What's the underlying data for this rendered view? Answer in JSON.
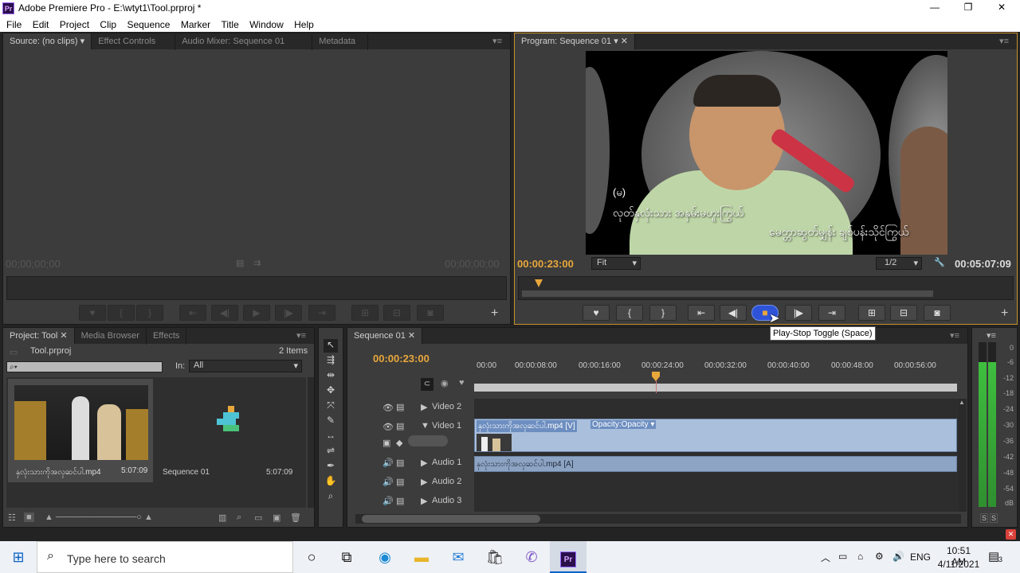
{
  "window": {
    "title": "Adobe Premiere Pro - E:\\wtyt1\\Tool.prproj *",
    "app_icon": "Pr",
    "controls": {
      "minimize": "—",
      "maximize": "❐",
      "close": "✕"
    }
  },
  "menu": [
    "File",
    "Edit",
    "Project",
    "Clip",
    "Sequence",
    "Marker",
    "Title",
    "Window",
    "Help"
  ],
  "source_panel": {
    "tabs": [
      "Source: (no clips)",
      "Effect Controls",
      "Audio Mixer: Sequence 01",
      "Metadata"
    ],
    "timecode_left": "00;00;00;00",
    "timecode_right": "00;00;00;00"
  },
  "program_panel": {
    "tab": "Program: Sequence 01",
    "timecode_left": "00:00:23:00",
    "fit_label": "Fit",
    "resolution": "1/2",
    "timecode_right": "00:05:07:09",
    "subtitle_tag": "(မ)",
    "subtitle_line1": "လုတ်နှလုံးသား အနှမ်းမဟူးကြွယ်",
    "subtitle_line2": "မေတ္တာဆွတ်မျှန်း ချစ်ပန်းသိုင်ကြွယ်",
    "tooltip": "Play-Stop Toggle (Space)"
  },
  "project_panel": {
    "tabs": [
      "Project: Tool",
      "Media Browser",
      "Effects"
    ],
    "project_name": "Tool.prproj",
    "item_count": "2 Items",
    "in_label": "In:",
    "in_value": "All",
    "items": [
      {
        "name": "နှလုံးသားကိုအလှဆင်ပါ.mp4",
        "duration": "5:07:09"
      },
      {
        "name": "Sequence 01",
        "duration": "5:07:09"
      }
    ]
  },
  "timeline_panel": {
    "tab": "Sequence 01",
    "timecode": "00:00:23:00",
    "ruler": [
      "00:00",
      "00:00:08:00",
      "00:00:16:00",
      "00:00:24:00",
      "00:00:32:00",
      "00:00:40:00",
      "00:00:48:00",
      "00:00:56:00"
    ],
    "tracks": [
      {
        "name": "Video 2"
      },
      {
        "name": "Video 1"
      },
      {
        "name": "Audio 1"
      },
      {
        "name": "Audio 2"
      },
      {
        "name": "Audio 3"
      }
    ],
    "video_clip": "နှလုံးသားကိုအလှဆင်ပါ.mp4 [V]",
    "opacity_label": "Opacity:Opacity ▾",
    "audio_clip": "နှလုံးသားကိုအလှဆင်ပါ.mp4 [A]"
  },
  "audio_meter": {
    "labels": [
      "0",
      "-6",
      "-12",
      "-18",
      "-24",
      "-30",
      "-36",
      "-42",
      "-48",
      "-54",
      "dB"
    ],
    "bottom": [
      "S",
      "S"
    ]
  },
  "taskbar": {
    "search_placeholder": "Type here to search",
    "lang": "ENG",
    "time": "10:51 AM",
    "date": "4/11/2021",
    "notifications": "3"
  },
  "colors": {
    "accent": "#e8a73b",
    "clip": "#8da4c4",
    "select": "#2e53d6"
  }
}
